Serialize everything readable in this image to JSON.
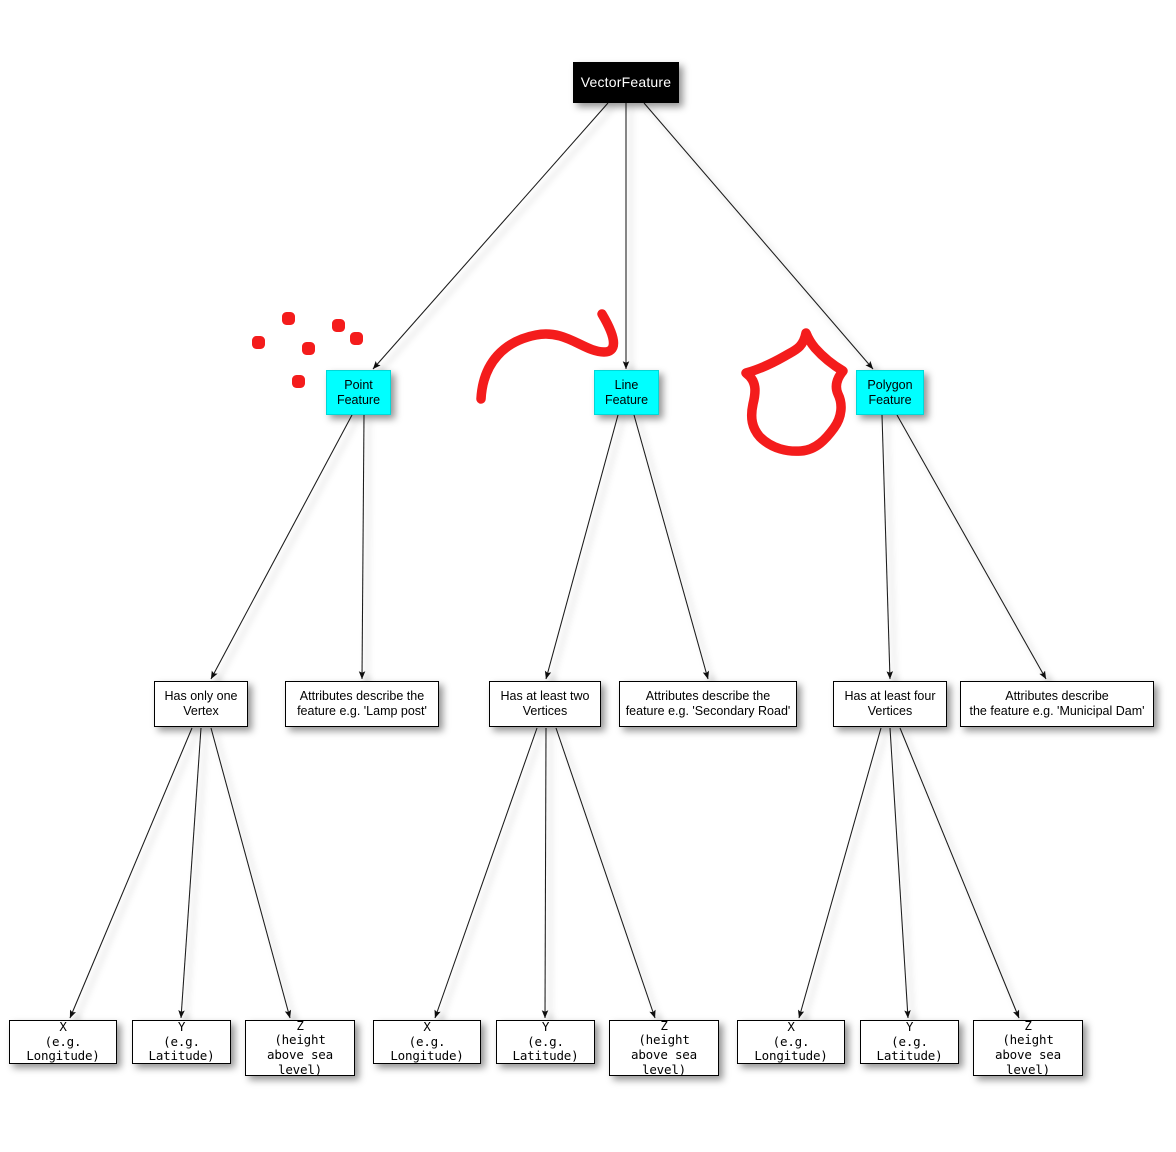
{
  "diagram": {
    "title": "VectorFeature hierarchy",
    "background": "#ffffff",
    "colors": {
      "root_fill": "#000000",
      "root_text": "#ffffff",
      "feature_fill": "#00ffff",
      "node_fill": "#ffffff",
      "node_border": "#000000",
      "edge": "#1a1a1a",
      "illustration_red": "#f41c1c"
    }
  },
  "root": {
    "label": "VectorFeature"
  },
  "features": [
    {
      "label": "Point\nFeature"
    },
    {
      "label": "Line\nFeature"
    },
    {
      "label": "Polygon\nFeature"
    }
  ],
  "vertex_rules": [
    {
      "label": "Has only one\nVertex"
    },
    {
      "label": "Has at least two\nVertices"
    },
    {
      "label": "Has at least four\nVertices"
    }
  ],
  "attribute_notes": [
    {
      "label": "Attributes describe the\nfeature e.g. 'Lamp post'"
    },
    {
      "label": "Attributes describe the\nfeature e.g. 'Secondary Road'"
    },
    {
      "label": "Attributes describe\nthe feature e.g. 'Municipal Dam'"
    }
  ],
  "coordinates": [
    {
      "label": "X\n(e.g. Longitude)"
    },
    {
      "label": "Y\n(e.g. Latitude)"
    },
    {
      "label": "Z\n(height\nabove sea level)"
    },
    {
      "label": "X\n(e.g. Longitude)"
    },
    {
      "label": "Y\n(e.g. Latitude)"
    },
    {
      "label": "Z\n(height\nabove sea level)"
    },
    {
      "label": "X\n(e.g. Longitude)"
    },
    {
      "label": "Y\n(e.g. Latitude)"
    },
    {
      "label": "Z\n(height\nabove sea level)"
    }
  ],
  "illustrations": {
    "point_cloud": {
      "name": "point-cloud-illustration",
      "dot_count": 6
    },
    "line": {
      "name": "line-illustration"
    },
    "polygon": {
      "name": "polygon-illustration"
    }
  }
}
